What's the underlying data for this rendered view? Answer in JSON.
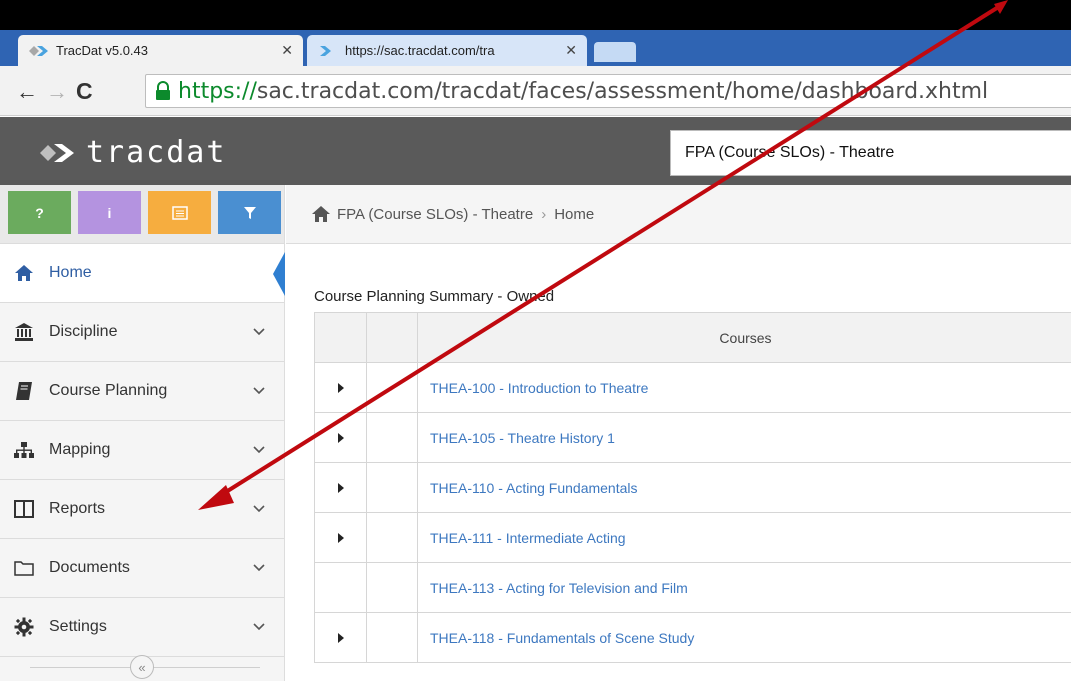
{
  "browser": {
    "tabs": [
      {
        "title": "TracDat v5.0.43",
        "active": true
      },
      {
        "title": "https://sac.tracdat.com/tra",
        "active": false
      }
    ],
    "url_scheme": "https://",
    "url_rest": "sac.tracdat.com/tracdat/faces/assessment/home/dashboard.xhtml"
  },
  "header": {
    "logo_text": "tracdat",
    "program_selected": "FPA (Course SLOs) - Theatre"
  },
  "quick_buttons": [
    {
      "label": "?",
      "color": "#6bab5e"
    },
    {
      "label": "i",
      "color": "#b493e0"
    },
    {
      "label": "list-icon",
      "color": "#f6ad3f"
    },
    {
      "label": "filter-icon",
      "color": "#4a8fd1"
    }
  ],
  "sidebar": {
    "items": [
      {
        "label": "Home",
        "icon": "home-icon"
      },
      {
        "label": "Discipline",
        "icon": "institution-icon"
      },
      {
        "label": "Course Planning",
        "icon": "book-icon"
      },
      {
        "label": "Mapping",
        "icon": "sitemap-icon"
      },
      {
        "label": "Reports",
        "icon": "columns-icon"
      },
      {
        "label": "Documents",
        "icon": "folder-icon"
      },
      {
        "label": "Settings",
        "icon": "gear-icon"
      }
    ],
    "collapse_label": "«"
  },
  "breadcrumb": {
    "program": "FPA (Course SLOs) - Theatre",
    "separator": "›",
    "page": "Home"
  },
  "summary": {
    "title": "Course Planning Summary - Owned",
    "column_header": "Courses",
    "rows": [
      {
        "course": "THEA-100 - Introduction to Theatre",
        "expandable": true
      },
      {
        "course": "THEA-105 - Theatre History 1",
        "expandable": true
      },
      {
        "course": "THEA-110 - Acting Fundamentals",
        "expandable": true
      },
      {
        "course": "THEA-111 - Intermediate Acting",
        "expandable": true
      },
      {
        "course": "THEA-113 - Acting for Television and Film",
        "expandable": false
      },
      {
        "course": "THEA-118 - Fundamentals of Scene Study",
        "expandable": true
      }
    ]
  },
  "annotation": {
    "color": "#c0090f"
  }
}
